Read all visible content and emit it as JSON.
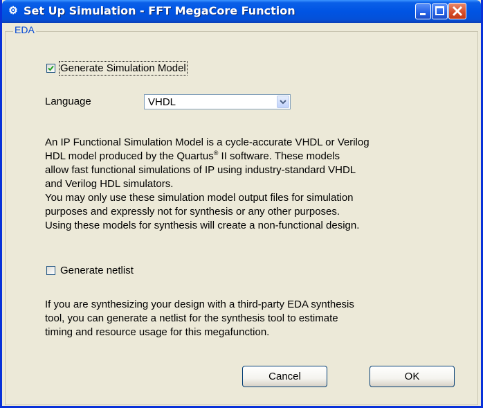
{
  "window": {
    "title": "Set Up Simulation - FFT MegaCore Function",
    "app_icon": "gear-app-icon"
  },
  "title_buttons": {
    "minimize": "minimize-icon",
    "maximize": "maximize-icon",
    "close": "close-icon"
  },
  "group": {
    "label": "EDA"
  },
  "generate_sim_model": {
    "label": "Generate Simulation Model",
    "checked": true
  },
  "language": {
    "label": "Language",
    "value": "VHDL"
  },
  "description": {
    "lines": [
      "An IP Functional Simulation Model is a cycle-accurate VHDL or Verilog",
      "HDL model produced by the Quartus",
      " II software. These models",
      "allow fast functional simulations of IP using industry-standard VHDL",
      "and Verilog HDL simulators.",
      "You may only use these simulation model output files for simulation",
      "purposes and expressly not for synthesis or any other purposes.",
      "Using these models for synthesis will create a non-functional design."
    ],
    "registered_mark": "®"
  },
  "generate_netlist": {
    "label": "Generate netlist",
    "checked": false
  },
  "netlist_help": {
    "lines": [
      "If you are synthesizing your design with a third-party EDA synthesis",
      "tool, you can generate a netlist for the synthesis tool to estimate",
      "timing and resource usage for this megafunction."
    ]
  },
  "buttons": {
    "cancel": "Cancel",
    "ok": "OK"
  },
  "colors": {
    "titlebar": "#0054e3",
    "frame": "#0831d9",
    "dialog_bg": "#ece9d8",
    "group_label": "#0046d5",
    "checkmark": "#21a121",
    "close_button": "#d8502c"
  }
}
